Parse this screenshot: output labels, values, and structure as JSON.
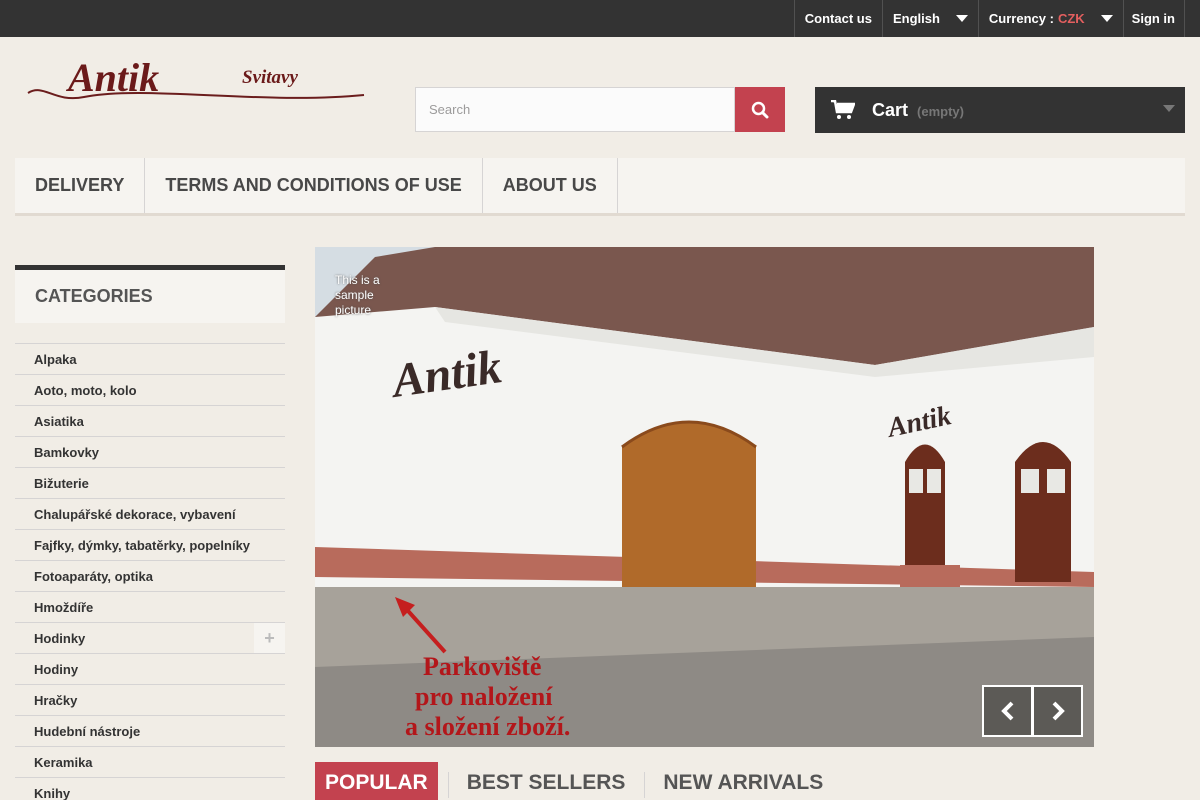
{
  "topbar": {
    "contact": "Contact us",
    "language": "English",
    "currency_label": "Currency :",
    "currency_value": "CZK",
    "signin": "Sign in"
  },
  "logo": {
    "main": "Antik",
    "sub": "Svitavy"
  },
  "search": {
    "placeholder": "Search"
  },
  "cart": {
    "title": "Cart",
    "status": "(empty)"
  },
  "menu": {
    "items": [
      "Delivery",
      "Terms and conditions of use",
      "About us"
    ]
  },
  "sidebar": {
    "title": "Categories",
    "items": [
      "Alpaka",
      "Aoto, moto, kolo",
      "Asiatika",
      "Bamkovky",
      "Bižuterie",
      "Chalupářské dekorace, vybavení",
      "Fajfky, dýmky, tabatěrky, popelníky",
      "Fotoaparáty, optika",
      "Hmoždíře",
      "Hodinky",
      "Hodiny",
      "Hračky",
      "Hudební nástroje",
      "Keramika",
      "Knihy"
    ]
  },
  "slider": {
    "caption": "This is a sample picture",
    "sign_left": "Antik",
    "sign_right": "Antik",
    "note_line1": "Parkoviště",
    "note_line2": "pro naložení",
    "note_line3": "a složení zboží."
  },
  "tabs": [
    "Popular",
    "Best sellers",
    "New arrivals"
  ],
  "colors": {
    "accent": "#c3424f",
    "dark": "#333333",
    "currency": "#e35f5f"
  }
}
